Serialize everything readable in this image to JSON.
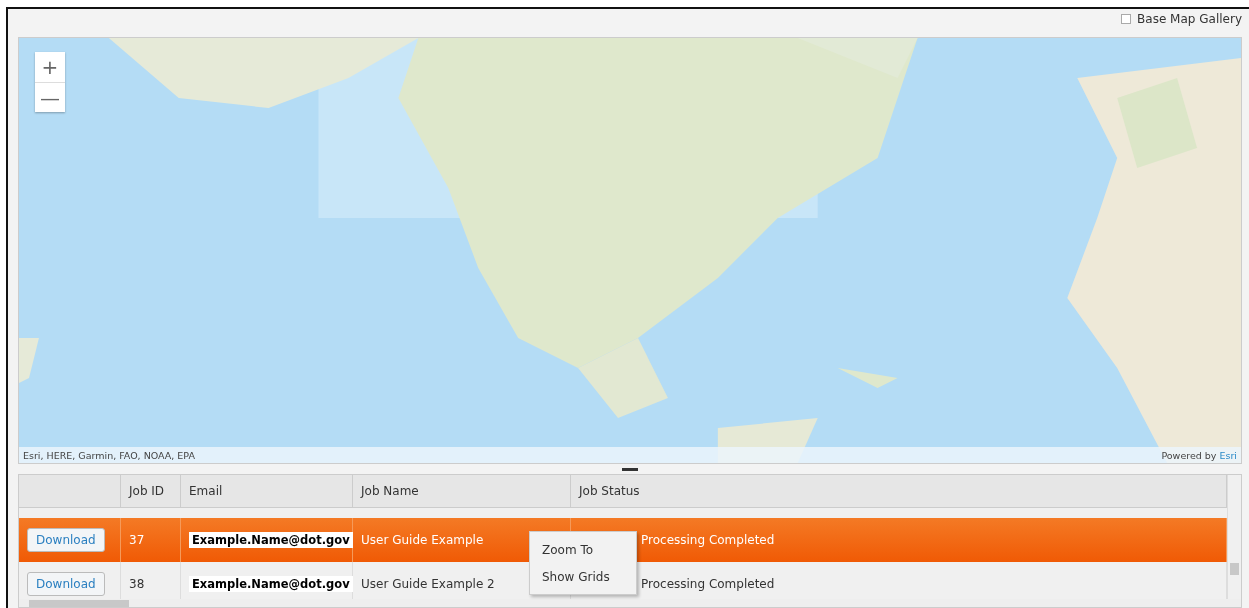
{
  "base_map_gallery": {
    "label": "Base Map Gallery",
    "checked": false
  },
  "map": {
    "zoom_in": "+",
    "zoom_out": "—",
    "attribution": "Esri, HERE, Garmin, FAO, NOAA, EPA",
    "powered_by": "Powered by",
    "powered_link": "Esri"
  },
  "table": {
    "columns": [
      "Job ID",
      "Email",
      "Job Name",
      "Job Status"
    ],
    "rows": [
      {
        "button": "Download",
        "job_id": "37",
        "email": "Example.Name@dot.gov",
        "job_name": "User Guide Example",
        "job_status": "Processing Completed",
        "selected": true
      },
      {
        "button": "Download",
        "job_id": "38",
        "email": "Example.Name@dot.gov",
        "job_name": "User Guide Example 2",
        "job_status": "Processing Completed",
        "selected": false
      }
    ]
  },
  "context_menu": {
    "items": [
      "Zoom To",
      "Show Grids"
    ]
  }
}
